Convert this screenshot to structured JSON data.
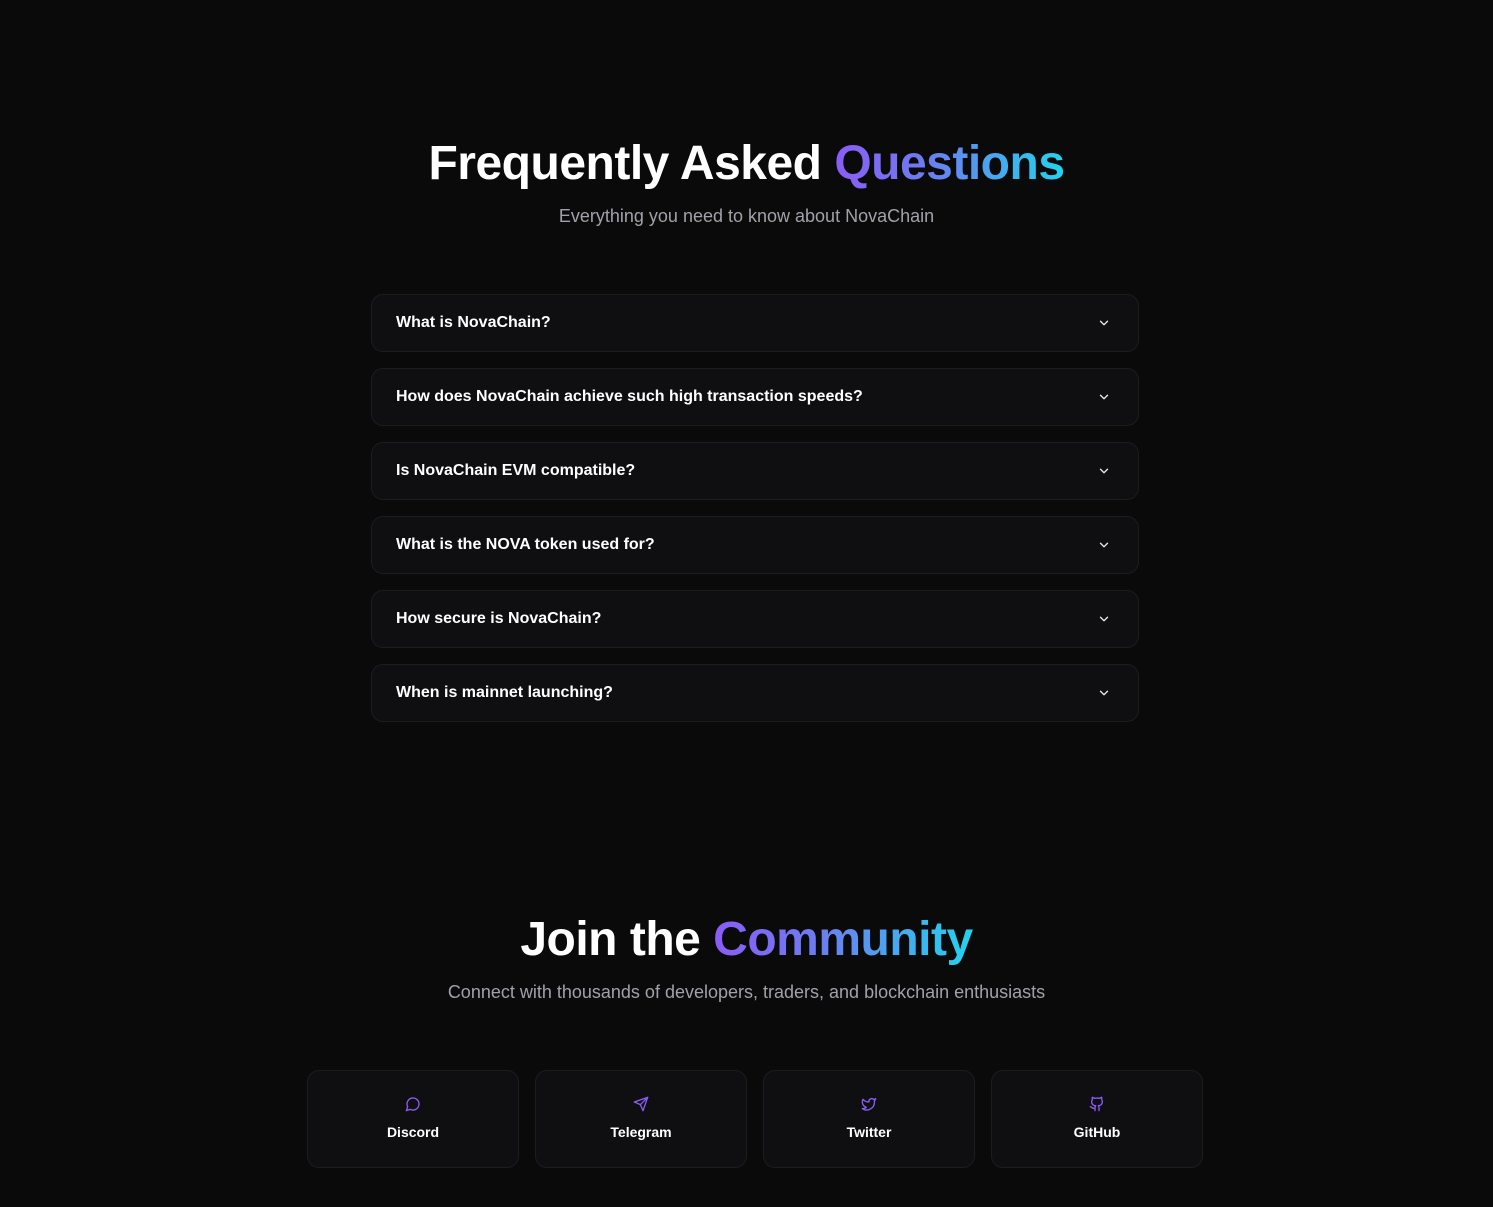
{
  "faq": {
    "title_plain": "Frequently Asked ",
    "title_accent": "Questions",
    "subtitle": "Everything you need to know about NovaChain",
    "items": [
      {
        "question": "What is NovaChain?",
        "icon": "chevron-down-icon"
      },
      {
        "question": "How does NovaChain achieve such high transaction speeds?",
        "icon": "chevron-down-icon"
      },
      {
        "question": "Is NovaChain EVM compatible?",
        "icon": "chevron-down-icon"
      },
      {
        "question": "What is the NOVA token used for?",
        "icon": "chevron-down-icon"
      },
      {
        "question": "How secure is NovaChain?",
        "icon": "chevron-down-icon"
      },
      {
        "question": "When is mainnet launching?",
        "icon": "chevron-down-icon"
      }
    ]
  },
  "community": {
    "title_plain": "Join the ",
    "title_accent": "Community",
    "subtitle": "Connect with thousands of developers, traders, and blockchain enthusiasts",
    "links": [
      {
        "label": "Discord",
        "icon": "message-circle-icon"
      },
      {
        "label": "Telegram",
        "icon": "send-icon"
      },
      {
        "label": "Twitter",
        "icon": "twitter-bird-icon"
      },
      {
        "label": "GitHub",
        "icon": "github-icon"
      }
    ]
  },
  "colors": {
    "background": "#0a0a0b",
    "card": "#0f0f12",
    "card_border": "#1c1c21",
    "muted_text": "#a1a1aa",
    "accent_start": "#8b5cf6",
    "accent_end": "#22d3ee",
    "icon_accent": "#8b5cf6"
  }
}
